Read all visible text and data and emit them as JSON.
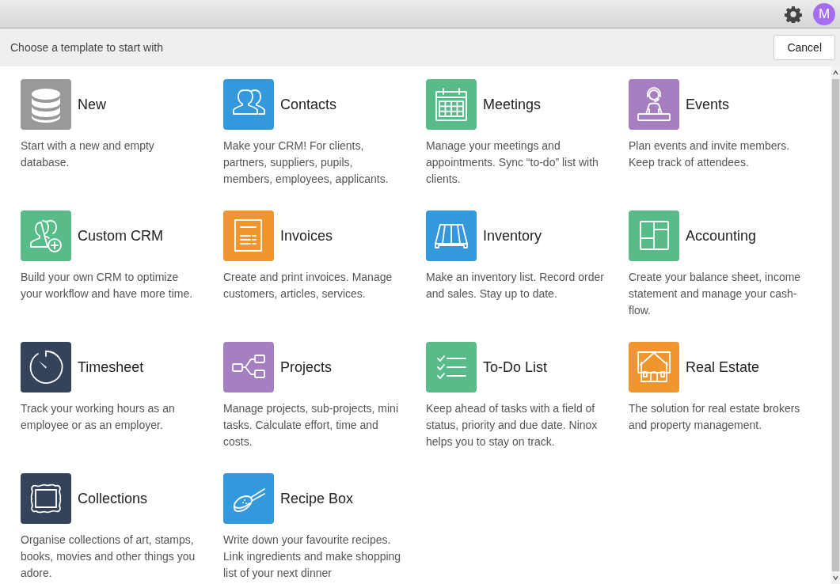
{
  "top_bar": {
    "avatar_letter": "M"
  },
  "header": {
    "prompt": "Choose a template to start with",
    "cancel_button": "Cancel"
  },
  "templates": [
    {
      "title": "New",
      "description": "Start with a new and empty database.",
      "color": "#999999",
      "kind": "database"
    },
    {
      "title": "Contacts",
      "description": "Make your CRM! For clients, partners, suppliers, pupils, members, employees, applicants.",
      "color": "#3398dc",
      "kind": "people"
    },
    {
      "title": "Meetings",
      "description": "Manage your meetings and appointments. Sync “to-do” list with clients.",
      "color": "#57bb8a",
      "kind": "calendar"
    },
    {
      "title": "Events",
      "description": "Plan events and invite members. Keep track of attendees.",
      "color": "#a57fc0",
      "kind": "headset"
    },
    {
      "title": "Custom CRM",
      "description": "Build your own CRM to optimize your workflow and have more time.",
      "color": "#57bb8a",
      "kind": "people-add"
    },
    {
      "title": "Invoices",
      "description": "Create and print invoices. Manage customers, articles, services.",
      "color": "#f0962e",
      "kind": "document"
    },
    {
      "title": "Inventory",
      "description": "Make an inventory list. Record order and sales. Stay up to date.",
      "color": "#3398dc",
      "kind": "pallet"
    },
    {
      "title": "Accounting",
      "description": "Create your balance sheet, income statement and manage your cash-flow.",
      "color": "#57bb8a",
      "kind": "layout"
    },
    {
      "title": "Timesheet",
      "description": "Track your working hours as an employee or as an employer.",
      "color": "#34435a",
      "kind": "stopwatch"
    },
    {
      "title": "Projects",
      "description": "Manage projects, sub-projects, mini tasks. Calculate effort, time and costs.",
      "color": "#a57fc0",
      "kind": "hierarchy"
    },
    {
      "title": "To-Do List",
      "description": "Keep ahead of tasks with a field of status, priority and due date. Ninox helps you to stay on track.",
      "color": "#57bb8a",
      "kind": "checklist"
    },
    {
      "title": "Real Estate",
      "description": "The solution for real estate brokers and property management.",
      "color": "#f0962e",
      "kind": "house"
    },
    {
      "title": "Collections",
      "description": "Organise collections of art, stamps, books, movies and other things you adore.",
      "color": "#34435a",
      "kind": "frame"
    },
    {
      "title": "Recipe Box",
      "description": "Write down your favourite recipes. Link ingredients and make shopping list of your next dinner",
      "color": "#3398dc",
      "kind": "spoon"
    }
  ]
}
